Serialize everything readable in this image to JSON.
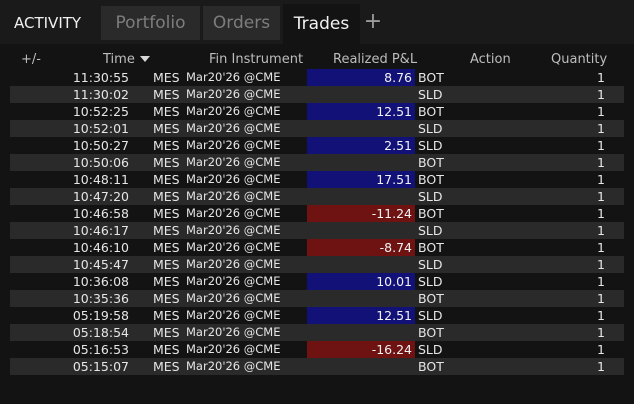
{
  "tabs": {
    "title": "ACTIVITY",
    "portfolio": "Portfolio",
    "orders": "Orders",
    "trades": "Trades",
    "add": "+"
  },
  "columns": {
    "plusminus": "+/-",
    "time": "Time",
    "instrument": "Fin Instrument",
    "pnl": "Realized P&L",
    "action": "Action",
    "quantity": "Quantity"
  },
  "colors": {
    "positive": "#111178",
    "negative": "#6e1212",
    "row_alt": "#2a2a2a"
  },
  "trades": [
    {
      "time": "11:30:55",
      "symbol": "MES",
      "expiry": "Mar20'26 @CME",
      "pnl": "8.76",
      "pnl_sign": "pos",
      "action": "BOT",
      "qty": "1"
    },
    {
      "time": "11:30:02",
      "symbol": "MES",
      "expiry": "Mar20'26 @CME",
      "pnl": "",
      "pnl_sign": "none",
      "action": "SLD",
      "qty": "1"
    },
    {
      "time": "10:52:25",
      "symbol": "MES",
      "expiry": "Mar20'26 @CME",
      "pnl": "12.51",
      "pnl_sign": "pos",
      "action": "BOT",
      "qty": "1"
    },
    {
      "time": "10:52:01",
      "symbol": "MES",
      "expiry": "Mar20'26 @CME",
      "pnl": "",
      "pnl_sign": "none",
      "action": "SLD",
      "qty": "1"
    },
    {
      "time": "10:50:27",
      "symbol": "MES",
      "expiry": "Mar20'26 @CME",
      "pnl": "2.51",
      "pnl_sign": "pos",
      "action": "SLD",
      "qty": "1"
    },
    {
      "time": "10:50:06",
      "symbol": "MES",
      "expiry": "Mar20'26 @CME",
      "pnl": "",
      "pnl_sign": "none",
      "action": "BOT",
      "qty": "1"
    },
    {
      "time": "10:48:11",
      "symbol": "MES",
      "expiry": "Mar20'26 @CME",
      "pnl": "17.51",
      "pnl_sign": "pos",
      "action": "BOT",
      "qty": "1"
    },
    {
      "time": "10:47:20",
      "symbol": "MES",
      "expiry": "Mar20'26 @CME",
      "pnl": "",
      "pnl_sign": "none",
      "action": "SLD",
      "qty": "1"
    },
    {
      "time": "10:46:58",
      "symbol": "MES",
      "expiry": "Mar20'26 @CME",
      "pnl": "-11.24",
      "pnl_sign": "neg",
      "action": "BOT",
      "qty": "1"
    },
    {
      "time": "10:46:17",
      "symbol": "MES",
      "expiry": "Mar20'26 @CME",
      "pnl": "",
      "pnl_sign": "none",
      "action": "SLD",
      "qty": "1"
    },
    {
      "time": "10:46:10",
      "symbol": "MES",
      "expiry": "Mar20'26 @CME",
      "pnl": "-8.74",
      "pnl_sign": "neg",
      "action": "BOT",
      "qty": "1"
    },
    {
      "time": "10:45:47",
      "symbol": "MES",
      "expiry": "Mar20'26 @CME",
      "pnl": "",
      "pnl_sign": "none",
      "action": "SLD",
      "qty": "1"
    },
    {
      "time": "10:36:08",
      "symbol": "MES",
      "expiry": "Mar20'26 @CME",
      "pnl": "10.01",
      "pnl_sign": "pos",
      "action": "SLD",
      "qty": "1"
    },
    {
      "time": "10:35:36",
      "symbol": "MES",
      "expiry": "Mar20'26 @CME",
      "pnl": "",
      "pnl_sign": "none",
      "action": "BOT",
      "qty": "1"
    },
    {
      "time": "05:19:58",
      "symbol": "MES",
      "expiry": "Mar20'26 @CME",
      "pnl": "12.51",
      "pnl_sign": "pos",
      "action": "SLD",
      "qty": "1"
    },
    {
      "time": "05:18:54",
      "symbol": "MES",
      "expiry": "Mar20'26 @CME",
      "pnl": "",
      "pnl_sign": "none",
      "action": "BOT",
      "qty": "1"
    },
    {
      "time": "05:16:53",
      "symbol": "MES",
      "expiry": "Mar20'26 @CME",
      "pnl": "-16.24",
      "pnl_sign": "neg",
      "action": "SLD",
      "qty": "1"
    },
    {
      "time": "05:15:07",
      "symbol": "MES",
      "expiry": "Mar20'26 @CME",
      "pnl": "",
      "pnl_sign": "none",
      "action": "BOT",
      "qty": "1"
    }
  ]
}
